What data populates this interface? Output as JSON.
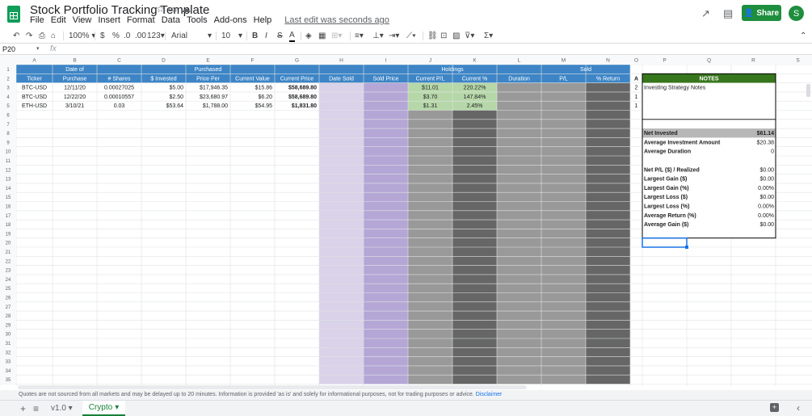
{
  "header": {
    "title": "Stock Portfolio Tracking Template",
    "menu": [
      "File",
      "Edit",
      "View",
      "Insert",
      "Format",
      "Data",
      "Tools",
      "Add-ons",
      "Help"
    ],
    "last_edit": "Last edit was seconds ago",
    "share_label": "Share",
    "avatar_letter": "S"
  },
  "toolbar": {
    "zoom": "100%",
    "currency": "$",
    "percent": "%",
    "dec_less": ".0",
    "dec_more": ".00",
    "more_formats": "123",
    "font": "Arial",
    "font_size": "10",
    "bold": "B",
    "italic": "I",
    "strike": "S",
    "text_color": "A"
  },
  "formula_bar": {
    "cell_ref": "P20",
    "fx": "fx"
  },
  "columns": [
    "A",
    "B",
    "C",
    "D",
    "E",
    "F",
    "G",
    "H",
    "I",
    "J",
    "K",
    "L",
    "M",
    "N",
    "O",
    "P",
    "Q",
    "R",
    "S"
  ],
  "rows": [
    "1",
    "2",
    "3",
    "4",
    "5",
    "6",
    "7",
    "8",
    "9",
    "10",
    "11",
    "12",
    "13",
    "14",
    "15",
    "16",
    "17",
    "18",
    "19",
    "20",
    "21",
    "22",
    "23",
    "24",
    "25",
    "26",
    "27",
    "28",
    "29",
    "30",
    "31",
    "32",
    "33",
    "34",
    "35"
  ],
  "table": {
    "group_holdings": "Holdings",
    "group_sold": "Sold",
    "headers": [
      "Ticker",
      "Date of Purchase",
      "# Shares",
      "$ Invested",
      "Purchased Price Per",
      "Current Value",
      "Current Price",
      "Date Sold",
      "Sold Price",
      "Current P/L",
      "Current %",
      "Duration",
      "P/L",
      "% Return"
    ],
    "rows": [
      [
        "BTC-USD",
        "12/11/20",
        "0.00027025",
        "$5.00",
        "$17,946.35",
        "$15.86",
        "$58,689.80",
        "",
        "",
        "$11.01",
        "220.22%",
        "",
        "",
        ""
      ],
      [
        "BTC-USD",
        "12/22/20",
        "0.00010557",
        "$2.50",
        "$23,680.97",
        "$6.20",
        "$58,689.80",
        "",
        "",
        "$3.70",
        "147.84%",
        "",
        "",
        ""
      ],
      [
        "ETH-USD",
        "3/10/21",
        "0.03",
        "$53.64",
        "$1,788.00",
        "$54.95",
        "$1,831.80",
        "",
        "",
        "$1.31",
        "2.45%",
        "",
        "",
        ""
      ]
    ]
  },
  "col_o": {
    "header": "A",
    "values": [
      "2",
      "1",
      "1"
    ]
  },
  "notes": {
    "header": "NOTES",
    "text": "Investing Strategy Notes",
    "stats_a": [
      {
        "label": "Net Invested",
        "value": "$61.14"
      },
      {
        "label": "Average Investment Amount",
        "value": "$20.38"
      },
      {
        "label": "Average Duration",
        "value": "0"
      }
    ],
    "stats_b": [
      {
        "label": "Net P/L ($) / Realized",
        "value": "$0.00"
      },
      {
        "label": "Largest Gain ($)",
        "value": "$0.00"
      },
      {
        "label": "Largest Gain (%)",
        "value": "0.00%"
      },
      {
        "label": "Largest Loss ($)",
        "value": "$0.00"
      },
      {
        "label": "Largest Loss (%)",
        "value": "0.00%"
      },
      {
        "label": "Average Return (%)",
        "value": "0.00%"
      },
      {
        "label": "Average Gain ($)",
        "value": "$0.00"
      }
    ]
  },
  "notice": {
    "text": "Quotes are not sourced from all markets and may be delayed up to 20 minutes. Information is provided 'as is' and solely for informational purposes, not for trading purposes or advice.",
    "link": "Disclaimer"
  },
  "sheets": {
    "other": "v1.0",
    "active": "Crypto"
  },
  "colors": {
    "header_blue": "#3d85c6",
    "notes_green": "#38761d",
    "lavender": "#d9d2e9",
    "mauve": "#b4a7d6",
    "green_light": "#b6d7a8",
    "grey_mid": "#999999",
    "grey_dark": "#666666",
    "grey_light": "#b7b7b7",
    "selection": "#1a73e8"
  }
}
